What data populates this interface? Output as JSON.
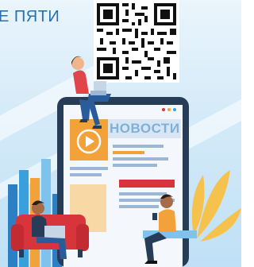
{
  "banner": {
    "headline": "Е ПЯТИ",
    "news_label": "НОВОСТИ"
  },
  "icons": {
    "qr": "qr-code-icon",
    "play": "play-icon"
  },
  "colors": {
    "headline": "#2a6fb0",
    "screen_frame": "#263c57",
    "news_text": "#ffffff",
    "accent_red": "#d8343b",
    "accent_orange": "#f3a23a",
    "sofa": "#d8343b"
  }
}
